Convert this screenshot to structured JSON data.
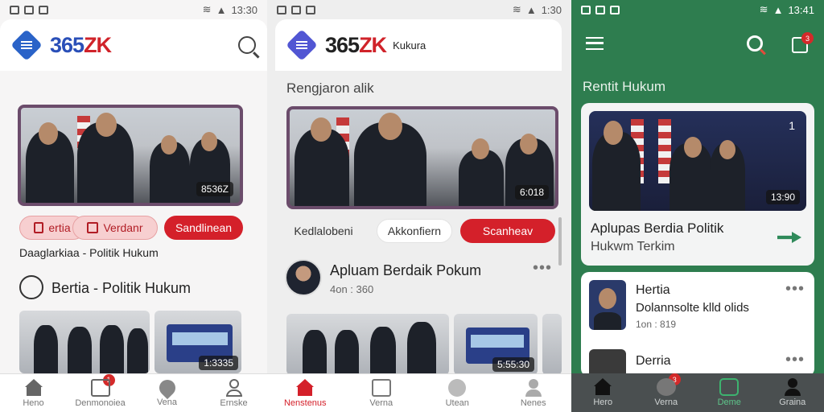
{
  "colors": {
    "brand_red": "#d4202a",
    "brand_blue": "#2a63c8",
    "green_bg": "#2e7d4f"
  },
  "screen1": {
    "status_time": "13:30",
    "logo": "365ZK",
    "hero_badge": "8536Z",
    "buttons": [
      "ertia",
      "Verdanr",
      "Sandlinean"
    ],
    "subtitle": "Daaglarkiaa - Politik Hukum",
    "section_title": "Bertia - Politik Hukum",
    "thumb_badge": "1:3335",
    "nav": [
      "Heno",
      "Denmonoiea",
      "Vena",
      "Ernske"
    ],
    "nav_badge": "1"
  },
  "screen2": {
    "status_time": "1:30",
    "logo": "365ZK",
    "logo_suffix": "Kukura",
    "section": "Rengjaron alik",
    "hero_badge": "6:018",
    "tabs": [
      "Kedlalobeni",
      "Akkonfiern",
      "Scanheav"
    ],
    "article_title": "Apluam Berdaik Pokum",
    "article_meta": "4on : 360",
    "thumb_badge": "5:55:30",
    "nav": [
      "Nenstenus",
      "Verna",
      "Utean",
      "Nenes"
    ]
  },
  "screen3": {
    "status_time": "13:41",
    "notif": "3",
    "section": "Rentit Hukum",
    "hero_badge": "13:90",
    "hero_count": "1",
    "headline": "Aplupas Berdia Politik",
    "headline_sub": "Hukwm Terkim",
    "item1_title": "Hertia",
    "item1_sub": "Dolannsolte klld olids",
    "item1_meta": "1on : 819",
    "item2_title": "Derria",
    "nav": [
      "Hero",
      "Verna",
      "Deme",
      "Graina"
    ],
    "nav_badge": "3"
  }
}
